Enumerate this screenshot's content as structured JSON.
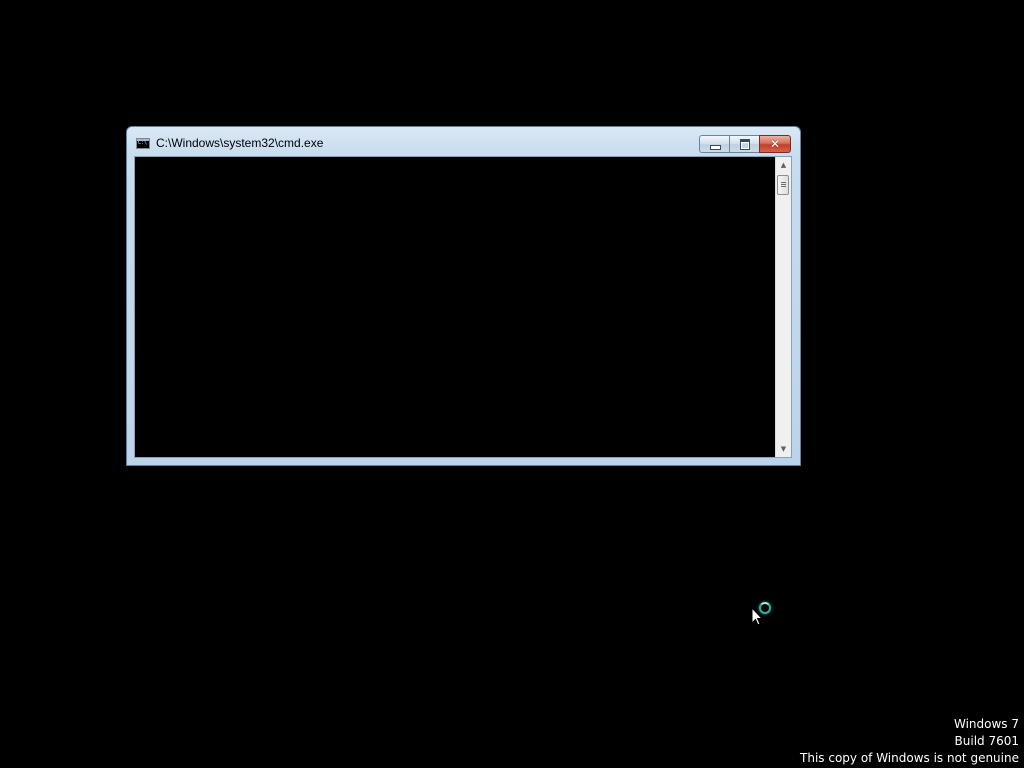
{
  "window": {
    "title": "C:\\Windows\\system32\\cmd.exe",
    "icon": "console-icon",
    "buttons": {
      "minimize": "minimize-icon",
      "maximize": "maximize-icon",
      "close": "close-icon"
    },
    "console_text": ""
  },
  "cursor": {
    "state": "busy",
    "icon": "arrow-busy-icon"
  },
  "watermark": {
    "line1": "Windows 7",
    "line2": "Build 7601",
    "line3": "This copy of Windows is not genuine"
  },
  "colors": {
    "desktop_background": "#000000",
    "window_frame": "#c6dcef",
    "close_button": "#c2402a",
    "busy_ring": "#2fb0a0"
  }
}
